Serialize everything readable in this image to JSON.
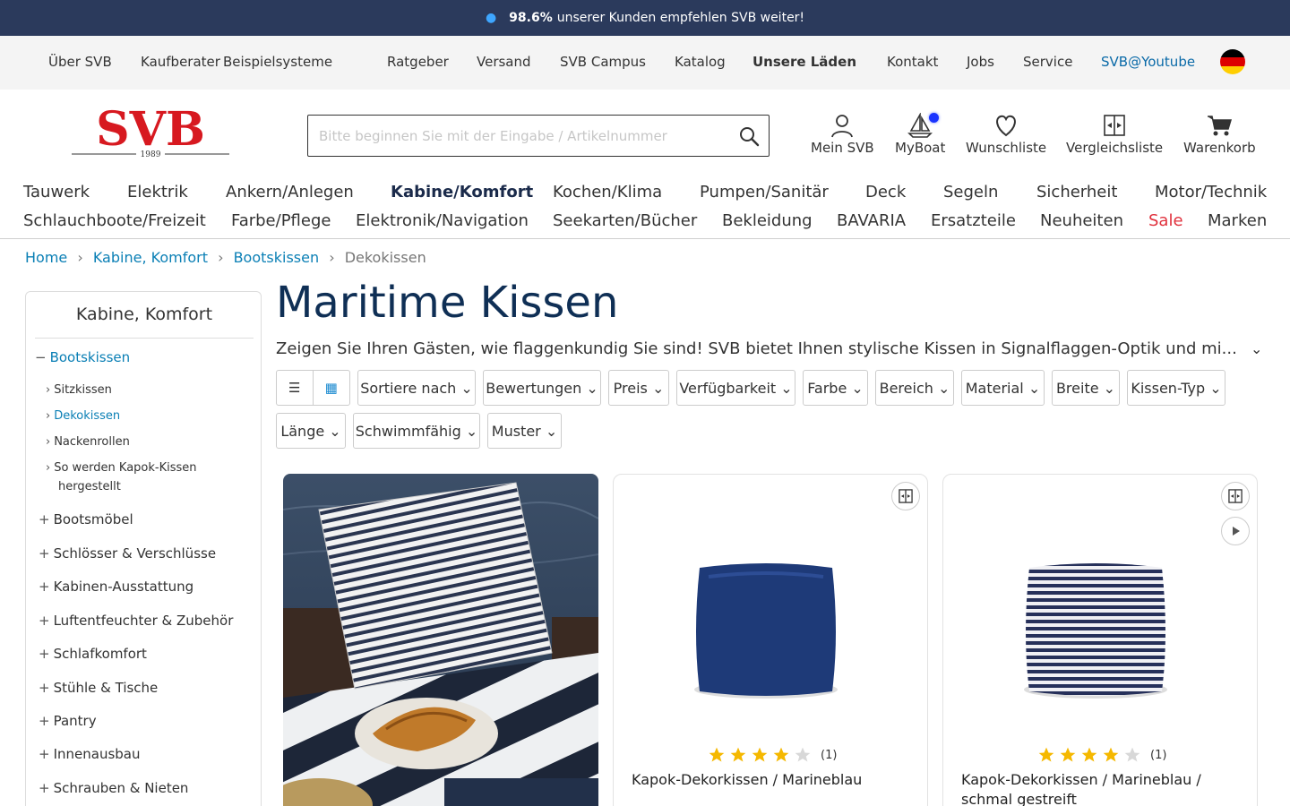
{
  "announcement": {
    "highlight": "98.6%",
    "text": "unserer Kunden empfehlen SVB weiter!",
    "icon": "info-icon"
  },
  "service_nav": [
    "Über SVB",
    "Kaufberater",
    "Beispielsysteme",
    "Ratgeber",
    "Versand",
    "SVB Campus",
    "Katalog",
    "Unsere Läden",
    "Kontakt",
    "Jobs",
    "Service",
    "SVB@Youtube"
  ],
  "logo": {
    "text": "SVB",
    "year": "1989"
  },
  "search": {
    "placeholder": "Bitte beginnen Sie mit der Eingabe / Artikelnummer"
  },
  "header_actions": {
    "account": "Mein SVB",
    "myboat": "MyBoat",
    "wishlist": "Wunschliste",
    "compare": "Vergleichsliste",
    "cart": "Warenkorb"
  },
  "category_nav": {
    "row1": [
      "Tauwerk",
      "Elektrik",
      "Ankern/Anlegen",
      "Kabine/Komfort",
      "Kochen/Klima",
      "Pumpen/Sanitär",
      "Deck",
      "Segeln",
      "Sicherheit",
      "Motor/Technik"
    ],
    "row2": [
      "Schlauchboote/Freizeit",
      "Farbe/Pflege",
      "Elektronik/Navigation",
      "Seekarten/Bücher",
      "Bekleidung",
      "BAVARIA",
      "Ersatzteile",
      "Neuheiten",
      "Sale",
      "Marken"
    ]
  },
  "breadcrumb": [
    "Home",
    "Kabine, Komfort",
    "Bootskissen",
    "Dekokissen"
  ],
  "sidebar": {
    "title": "Kabine, Komfort",
    "current": "Bootskissen",
    "sub": [
      "Sitzkissen",
      "Dekokissen",
      "Nackenrollen",
      "So werden Kapok-Kissen",
      "hergestellt"
    ],
    "items": [
      "Bootsmöbel",
      "Schlösser & Verschlüsse",
      "Kabinen-Ausstattung",
      "Luftentfeuchter & Zubehör",
      "Schlafkomfort",
      "Stühle & Tische",
      "Pantry",
      "Innenausbau",
      "Schrauben & Nieten"
    ]
  },
  "main": {
    "title": "Maritime Kissen",
    "intro": "Zeigen Sie Ihren Gästen, wie flaggenkundig Sie sind! SVB bietet Ihnen stylische Kissen in Signalflaggen-Optik und mi..."
  },
  "filters": [
    "Sortiere nach",
    "Bewertungen",
    "Preis",
    "Verfügbarkeit",
    "Farbe",
    "Bereich",
    "Material",
    "Breite",
    "Kissen-Typ",
    "Länge",
    "Schwimmfähig",
    "Muster"
  ],
  "products": [
    {
      "name": "Kapok-Dekorkissen / Marineblau",
      "rating": 4,
      "reviews": "(1)"
    },
    {
      "name": "Kapok-Dekorkissen / Marineblau / schmal gestreift",
      "rating": 4,
      "reviews": "(1)"
    }
  ],
  "colors": {
    "topbar": "#2b3a5c",
    "link": "#0a7fb5",
    "title": "#0f2f55",
    "sale": "#e0303c",
    "star": "#f5b800"
  }
}
